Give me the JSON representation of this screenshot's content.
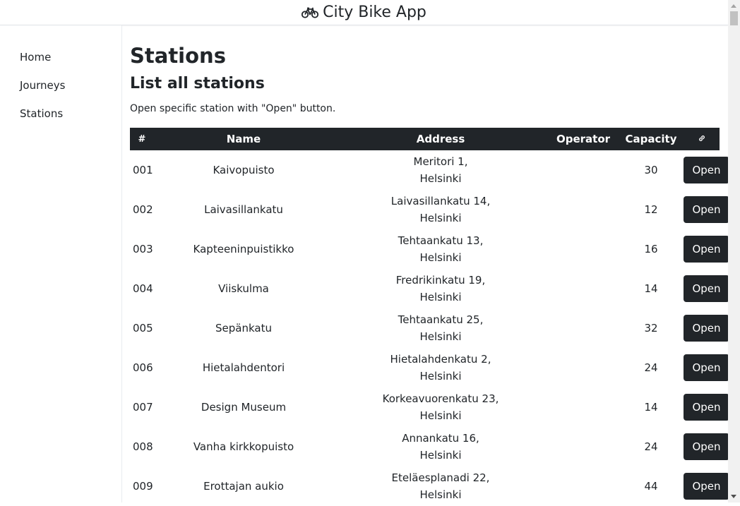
{
  "app": {
    "title": "City Bike App",
    "icon": "bicycle-icon"
  },
  "sidebar": {
    "items": [
      {
        "label": "Home"
      },
      {
        "label": "Journeys"
      },
      {
        "label": "Stations"
      }
    ]
  },
  "page": {
    "title": "Stations",
    "section_title": "List all stations",
    "intro": "Open specific station with \"Open\" button."
  },
  "table": {
    "headers": {
      "num": "#",
      "name": "Name",
      "address": "Address",
      "operator": "Operator",
      "capacity": "Capacity",
      "link_icon": "link-icon"
    },
    "rows": [
      {
        "num": "001",
        "name": "Kaivopuisto",
        "street": "Meritori 1,",
        "city": "Helsinki",
        "operator": "",
        "capacity": "30",
        "action": "Open"
      },
      {
        "num": "002",
        "name": "Laivasillankatu",
        "street": "Laivasillankatu 14,",
        "city": "Helsinki",
        "operator": "",
        "capacity": "12",
        "action": "Open"
      },
      {
        "num": "003",
        "name": "Kapteeninpuistikko",
        "street": "Tehtaankatu 13,",
        "city": "Helsinki",
        "operator": "",
        "capacity": "16",
        "action": "Open"
      },
      {
        "num": "004",
        "name": "Viiskulma",
        "street": "Fredrikinkatu 19,",
        "city": "Helsinki",
        "operator": "",
        "capacity": "14",
        "action": "Open"
      },
      {
        "num": "005",
        "name": "Sepänkatu",
        "street": "Tehtaankatu 25,",
        "city": "Helsinki",
        "operator": "",
        "capacity": "32",
        "action": "Open"
      },
      {
        "num": "006",
        "name": "Hietalahdentori",
        "street": "Hietalahdenkatu 2,",
        "city": "Helsinki",
        "operator": "",
        "capacity": "24",
        "action": "Open"
      },
      {
        "num": "007",
        "name": "Design Museum",
        "street": "Korkeavuorenkatu 23,",
        "city": "Helsinki",
        "operator": "",
        "capacity": "14",
        "action": "Open"
      },
      {
        "num": "008",
        "name": "Vanha kirkkopuisto",
        "street": "Annankatu 16,",
        "city": "Helsinki",
        "operator": "",
        "capacity": "24",
        "action": "Open"
      },
      {
        "num": "009",
        "name": "Erottajan aukio",
        "street": "Eteläesplanadi 22,",
        "city": "Helsinki",
        "operator": "",
        "capacity": "44",
        "action": "Open"
      }
    ]
  },
  "colors": {
    "header_bg": "#212529",
    "button_bg": "#212529",
    "text": "#212529"
  }
}
